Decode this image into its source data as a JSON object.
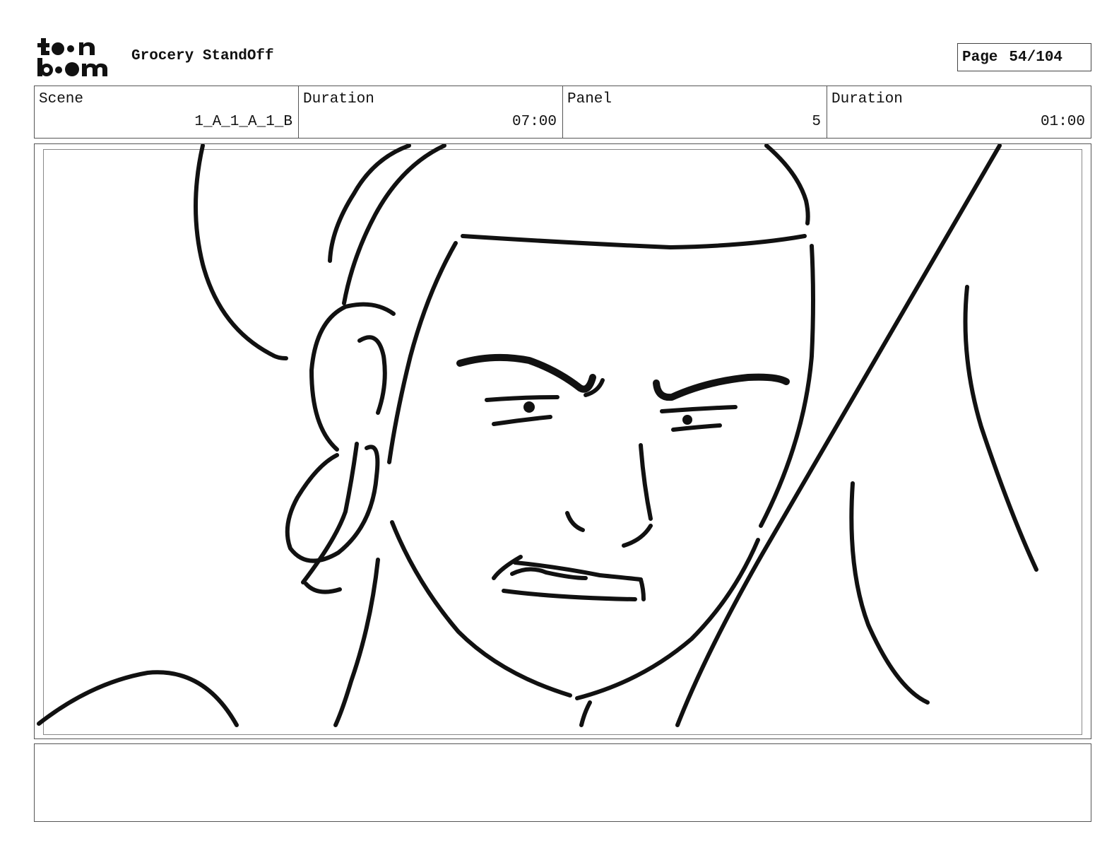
{
  "header": {
    "logo_text_top": "t••n",
    "logo_text_bottom": "b••m",
    "project_title": "Grocery StandOff",
    "page_label": "Page",
    "page_number": "54/104"
  },
  "info": {
    "scene_label": "Scene",
    "scene_value": "1_A_1_A_1_B",
    "scene_duration_label": "Duration",
    "scene_duration_value": "07:00",
    "panel_label": "Panel",
    "panel_value": "5",
    "panel_duration_label": "Duration",
    "panel_duration_value": "01:00"
  },
  "panel": {
    "drawing": "sketch",
    "stroke_color": "#111111"
  },
  "notes": {
    "text": ""
  }
}
